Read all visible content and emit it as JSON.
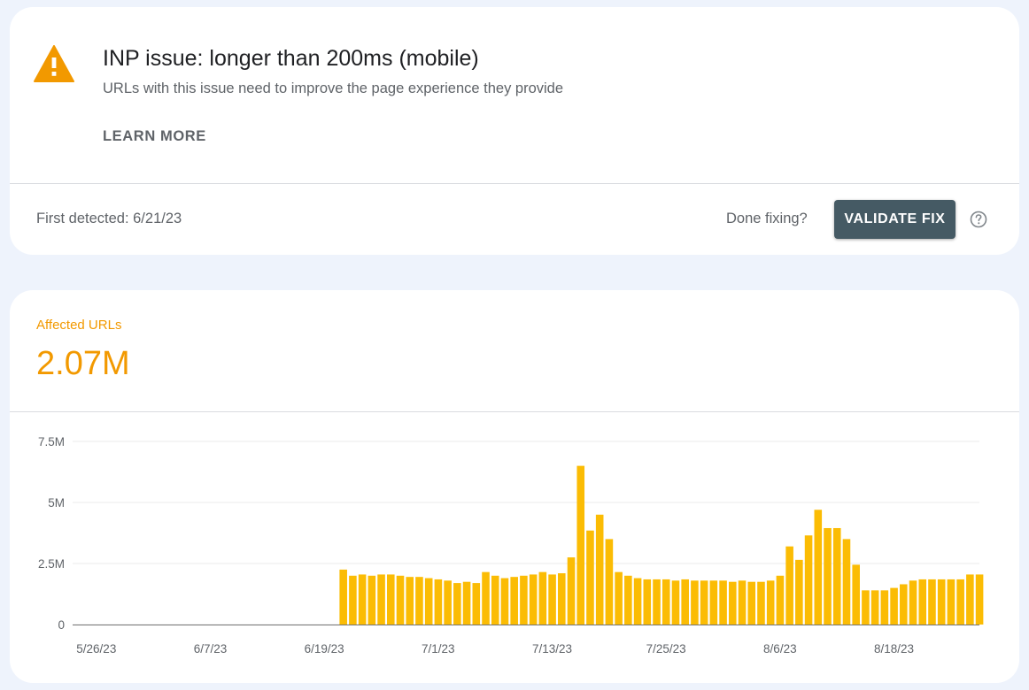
{
  "issue": {
    "title": "INP issue: longer than 200ms (mobile)",
    "subtitle": "URLs with this issue need to improve the page experience they provide",
    "learn_more_label": "LEARN MORE",
    "first_detected": "First detected: 6/21/23",
    "done_fixing_label": "Done fixing?",
    "validate_label": "VALIDATE FIX",
    "warning_color": "#f29900",
    "warning_icon": "warning-icon",
    "help_icon": "help-circle-icon"
  },
  "summary": {
    "label": "Affected URLs",
    "value": "2.07M",
    "accent_color": "#f29900"
  },
  "chart_data": {
    "type": "bar",
    "title": "",
    "xlabel": "",
    "ylabel": "",
    "bar_color": "#fbbc04",
    "ylim": [
      0,
      7.5
    ],
    "unit": "M",
    "y_ticks": [
      {
        "value": 7.5,
        "label": "7.5M"
      },
      {
        "value": 5,
        "label": "5M"
      },
      {
        "value": 2.5,
        "label": "2.5M"
      },
      {
        "value": 0,
        "label": "0"
      }
    ],
    "grid": true,
    "start_date": "5/24/23",
    "x_ticks": [
      "5/26/23",
      "6/7/23",
      "6/19/23",
      "7/1/23",
      "7/13/23",
      "7/25/23",
      "8/6/23",
      "8/18/23"
    ],
    "series": [
      {
        "values": [
          0,
          0,
          0,
          0,
          0,
          0,
          0,
          0,
          0,
          0,
          0,
          0,
          0,
          0,
          0,
          0,
          0,
          0,
          0,
          0,
          0,
          0,
          0,
          0,
          0,
          0,
          0,
          0,
          2.25,
          2.0,
          2.05,
          2.0,
          2.05,
          2.05,
          2.0,
          1.95,
          1.95,
          1.9,
          1.85,
          1.8,
          1.7,
          1.75,
          1.7,
          2.15,
          2.0,
          1.9,
          1.95,
          2.0,
          2.05,
          2.15,
          2.05,
          2.1,
          2.75,
          6.5,
          3.85,
          4.5,
          3.5,
          2.15,
          2.0,
          1.9,
          1.85,
          1.85,
          1.85,
          1.8,
          1.85,
          1.8,
          1.8,
          1.8,
          1.8,
          1.75,
          1.8,
          1.75,
          1.75,
          1.8,
          2.0,
          3.2,
          2.65,
          3.65,
          4.7,
          3.95,
          3.95,
          3.5,
          2.45,
          1.4,
          1.4,
          1.4,
          1.5,
          1.65,
          1.8,
          1.85,
          1.85,
          1.85,
          1.85,
          1.85,
          2.05,
          2.05
        ]
      }
    ]
  }
}
